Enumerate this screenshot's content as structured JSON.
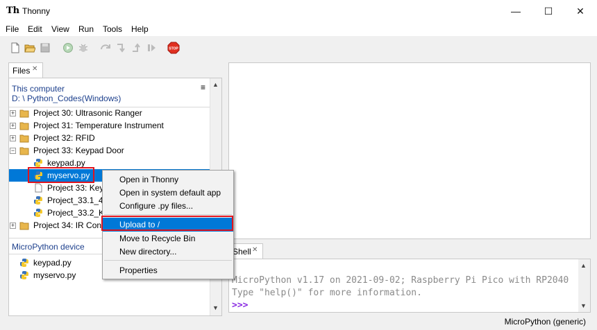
{
  "window": {
    "title": "Thonny",
    "minimize": "—",
    "maximize": "☐",
    "close": "✕"
  },
  "menu": [
    "File",
    "Edit",
    "View",
    "Run",
    "Tools",
    "Help"
  ],
  "toolbar": {
    "icons": [
      "new-file-icon",
      "open-folder-icon",
      "save-icon",
      "run-icon",
      "debug-icon",
      "step-over-icon",
      "step-into-icon",
      "step-out-icon",
      "resume-icon",
      "stop-icon"
    ],
    "stop_label": "STOP"
  },
  "files": {
    "tab_label": "Files",
    "tab_close": "✕",
    "computer_header": "This computer",
    "computer_path": "D: \\ Python_Codes(Windows)",
    "menu_icon": "≡",
    "tree": [
      {
        "label": "Project 30:  Ultrasonic Ranger",
        "type": "folder",
        "expander": "+"
      },
      {
        "label": "Project 31:  Temperature Instrument",
        "type": "folder",
        "expander": "+"
      },
      {
        "label": "Project 32:  RFID",
        "type": "folder",
        "expander": "+"
      },
      {
        "label": "Project 33:   Keypad Door",
        "type": "folder",
        "expander": "−"
      },
      {
        "label": "keypad.py",
        "type": "python"
      },
      {
        "label": "myservo.py",
        "type": "python",
        "selected": true
      },
      {
        "label": "Project 33:  Key",
        "type": "file"
      },
      {
        "label": "Project_33.1_4x",
        "type": "python"
      },
      {
        "label": "Project_33.2_Ke",
        "type": "python"
      },
      {
        "label": "Project 34:  IR Con",
        "type": "folder",
        "expander": "+"
      }
    ],
    "device_header": "MicroPython device",
    "device_files": [
      "keypad.py",
      "myservo.py"
    ]
  },
  "context_menu": {
    "items": [
      {
        "label": "Open in Thonny"
      },
      {
        "label": "Open in system default app"
      },
      {
        "label": "Configure .py files..."
      },
      {
        "label": "Upload to /",
        "highlighted": true
      },
      {
        "label": "Move to Recycle Bin"
      },
      {
        "label": "New directory..."
      },
      {
        "label": "Properties"
      }
    ]
  },
  "shell": {
    "tab_label": "Shell",
    "tab_close": "✕",
    "lines": [
      "MicroPython v1.17 on 2021-09-02; Raspberry Pi Pico with RP2040",
      "Type \"help()\" for more information."
    ],
    "prompt": ">>>"
  },
  "status": {
    "interpreter": "MicroPython (generic)"
  },
  "colors": {
    "selection": "#0078d7",
    "highlight_box": "#e0141e",
    "link_blue": "#1c3f8c",
    "prompt": "#8a2be2"
  }
}
